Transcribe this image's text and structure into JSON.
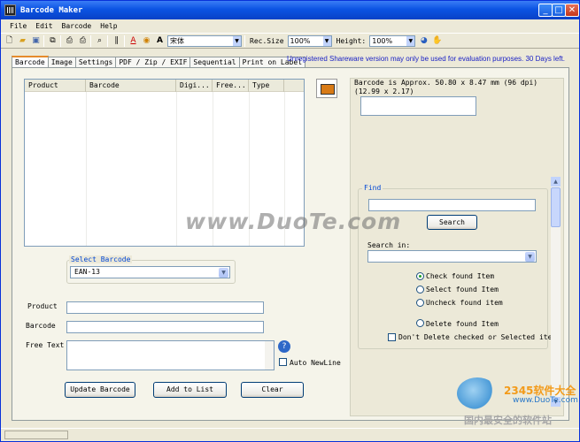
{
  "window": {
    "title": "Barcode Maker"
  },
  "title_buttons": {
    "minimize": "_",
    "maximize": "□",
    "close": "✕"
  },
  "menu": [
    "File",
    "Edit",
    "Barcode",
    "Help"
  ],
  "toolbar": {
    "font_name": "宋体",
    "rec_size_label": "Rec.Size",
    "rec_size_value": "100%",
    "height_label": "Height:",
    "height_value": "100%",
    "text_color_icon": "A",
    "font_icon": "A"
  },
  "tabs": [
    "Barcode",
    "Image",
    "Settings",
    "PDF / Zip / EXIF",
    "Sequential",
    "Print on Label"
  ],
  "notice": "Unregistered Shareware version may only be used for evaluation purposes. 30 Days left.",
  "table": {
    "columns": [
      "Product",
      "Barcode",
      "Digi...",
      "Free...",
      "Type"
    ]
  },
  "dimension_text": "Barcode is Approx. 50.80 x 8.47 mm  (96 dpi)  (12.99 x 2.17)",
  "find": {
    "legend": "Find",
    "search_button": "Search",
    "search_in_label": "Search in:",
    "search_in_value": "",
    "options": [
      {
        "label": "Check found Item",
        "selected": true
      },
      {
        "label": "Select found Item",
        "selected": false
      },
      {
        "label": "Uncheck found item",
        "selected": false
      },
      {
        "label": "Delete found Item",
        "selected": false
      }
    ],
    "dont_delete_label": "Don't Delete checked or Selected items"
  },
  "select_barcode": {
    "legend": "Select Barcode",
    "value": "EAN-13"
  },
  "form": {
    "product_label": "Product",
    "barcode_label": "Barcode",
    "free_text_label": "Free Text",
    "auto_newline_label": "Auto NewLine",
    "help_icon": "?"
  },
  "buttons": {
    "update": "Update Barcode",
    "add": "Add to List",
    "clear": "Clear"
  },
  "watermark": {
    "main": "www.DuoTe.com",
    "logo": "2345软件大全",
    "url": "www.DuoTe.com",
    "cn": "国内最安全的软件站"
  }
}
